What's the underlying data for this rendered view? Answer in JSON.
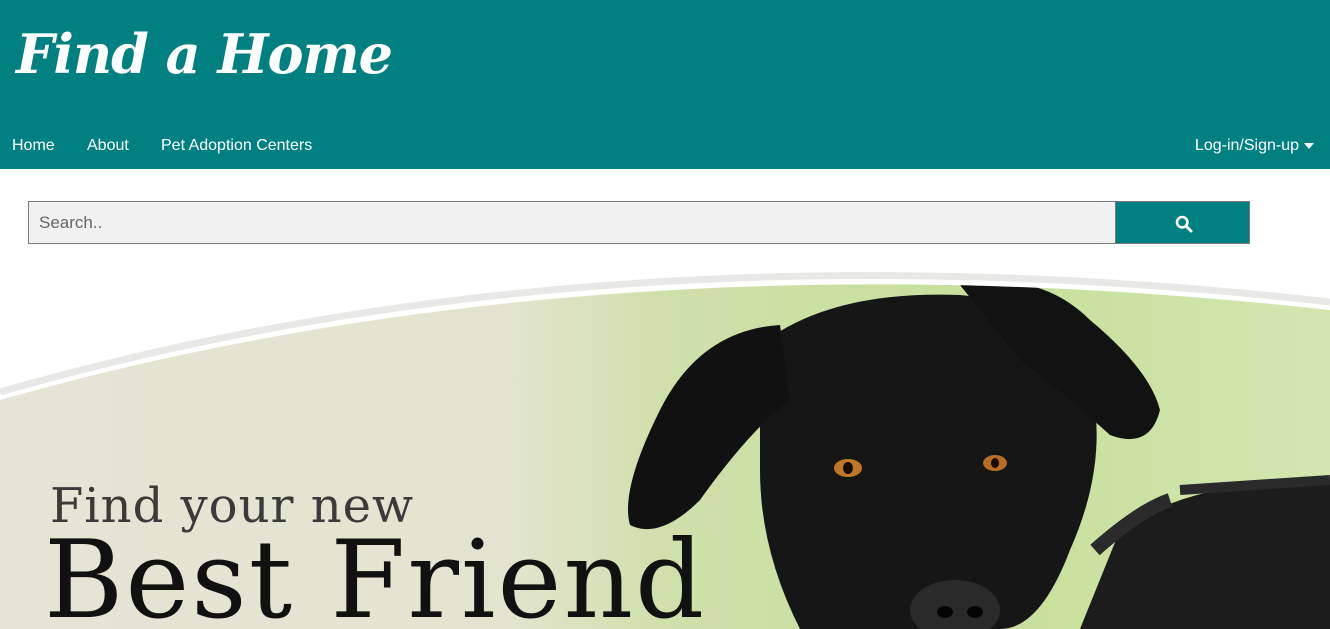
{
  "header": {
    "brand": "Find a Home",
    "background_color": "#008080"
  },
  "nav": {
    "items": [
      {
        "label": "Home"
      },
      {
        "label": "About"
      },
      {
        "label": "Pet Adoption Centers"
      }
    ],
    "account": {
      "label": "Log-in/Sign-up",
      "icon": "caret-down-icon"
    }
  },
  "search": {
    "placeholder": "Search..",
    "value": "",
    "button_icon": "search-icon"
  },
  "hero": {
    "line1": "Find your new",
    "line2": "Best Friend",
    "image": "black-dog-photo"
  }
}
